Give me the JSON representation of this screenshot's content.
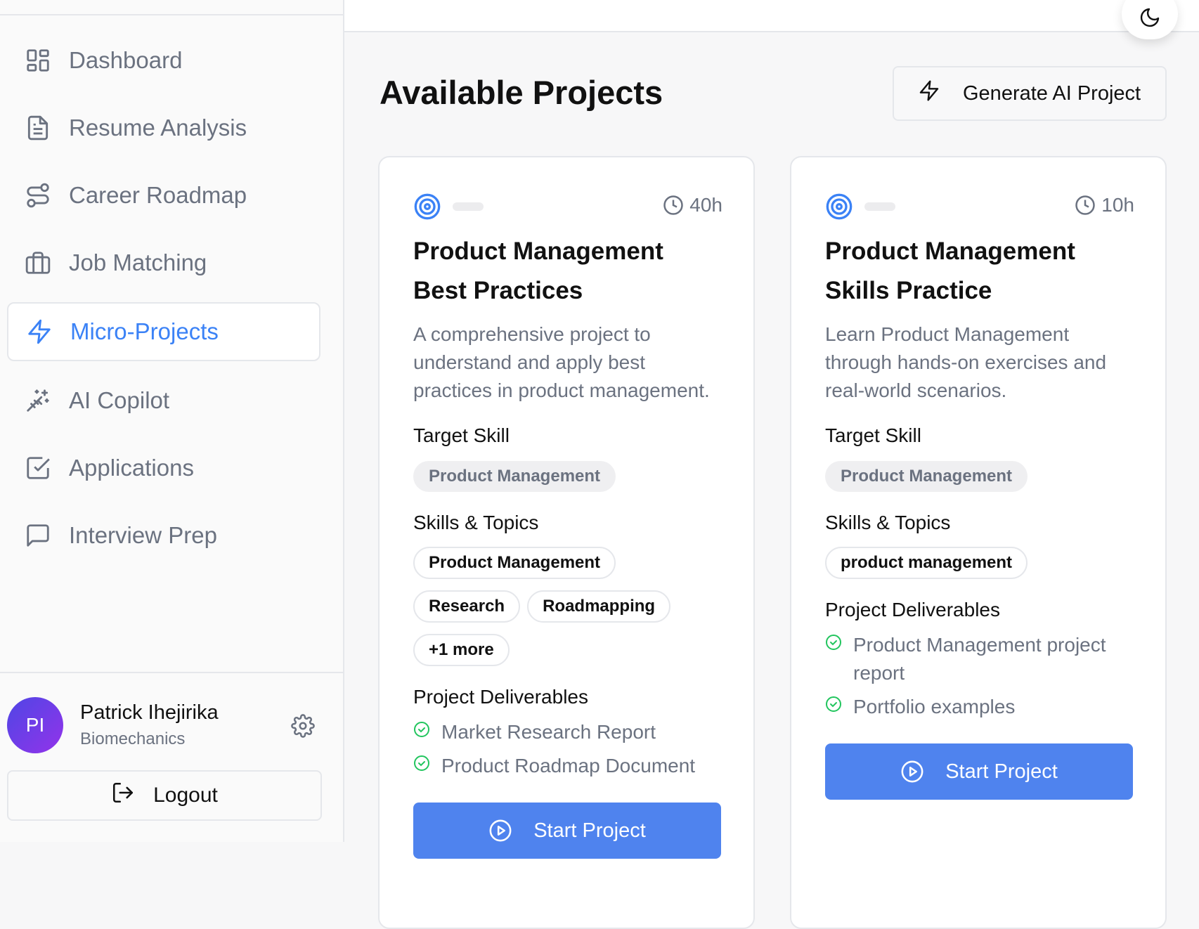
{
  "sidebar": {
    "items": [
      {
        "label": "Dashboard",
        "icon": "dashboard-icon"
      },
      {
        "label": "Resume Analysis",
        "icon": "file-text-icon"
      },
      {
        "label": "Career Roadmap",
        "icon": "route-icon"
      },
      {
        "label": "Job Matching",
        "icon": "briefcase-icon"
      },
      {
        "label": "Micro-Projects",
        "icon": "zap-icon",
        "active": true
      },
      {
        "label": "AI Copilot",
        "icon": "magic-wand-icon"
      },
      {
        "label": "Applications",
        "icon": "check-square-icon"
      },
      {
        "label": "Interview Prep",
        "icon": "message-square-icon"
      }
    ],
    "user": {
      "initials": "PI",
      "name": "Patrick Ihejirika",
      "role": "Biomechanics"
    },
    "logout_label": "Logout"
  },
  "main": {
    "title": "Available Projects",
    "generate_button": "Generate AI Project",
    "projects": [
      {
        "duration": "40h",
        "title_line1": "Product Management",
        "title_line2": "Best Practices",
        "description": "A comprehensive project to understand and apply best practices in product management.",
        "target_skill_label": "Target Skill",
        "target_skill": "Product Management",
        "skills_label": "Skills & Topics",
        "skills": [
          "Product Management",
          "Research",
          "Roadmapping",
          "+1 more"
        ],
        "deliverables_label": "Project Deliverables",
        "deliverables": [
          "Market Research Report",
          "Product Roadmap Document"
        ],
        "start_label": "Start Project"
      },
      {
        "duration": "10h",
        "title_line1": "Product Management",
        "title_line2": "Skills Practice",
        "description": "Learn Product Management through hands-on exercises and real-world scenarios.",
        "target_skill_label": "Target Skill",
        "target_skill": "Product Management",
        "skills_label": "Skills & Topics",
        "skills": [
          "product management"
        ],
        "deliverables_label": "Project Deliverables",
        "deliverables": [
          "Product Management project report",
          "Portfolio examples"
        ],
        "start_label": "Start Project"
      }
    ]
  },
  "colors": {
    "accent": "#3b82f6",
    "button": "#4f83ee",
    "success": "#22c55e",
    "muted": "#6b7280"
  }
}
